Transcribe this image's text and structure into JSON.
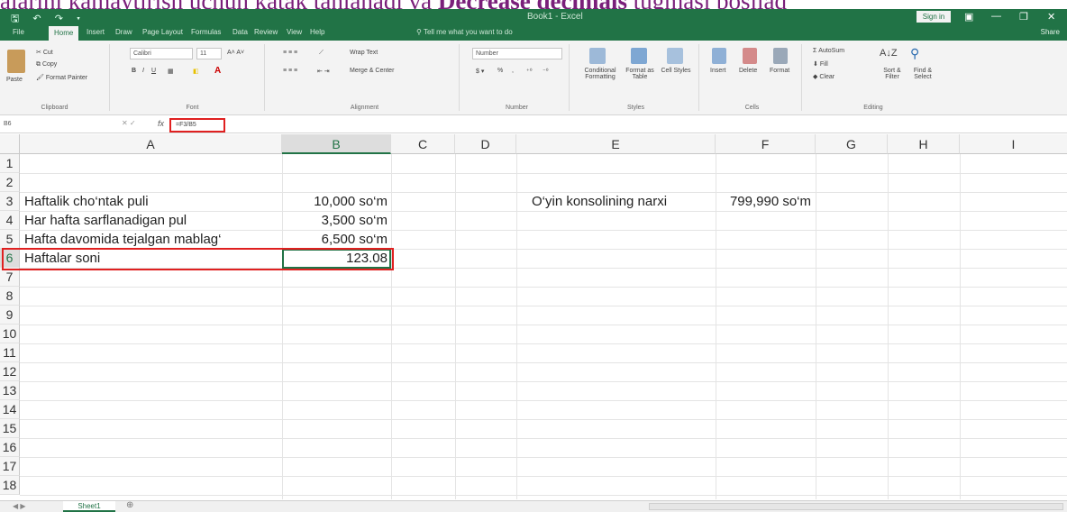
{
  "caption": {
    "prefix": "alarini kamaytirish uchun katak tanlanadi va ",
    "bold": "Decrease decimals",
    "suffix": " tugmasi bosilad"
  },
  "titlebar": {
    "quick_access": "🖫 ↶ ↷ ▾",
    "window_title": "Book1 - Excel",
    "signin": "Sign in",
    "minimize": "—",
    "restore": "❐",
    "close": "✕"
  },
  "tabs": [
    "File",
    "Home",
    "Insert",
    "Draw",
    "Page Layout",
    "Formulas",
    "Data",
    "Review",
    "View",
    "Help"
  ],
  "tell_me": "Tell me what you want to do",
  "share": "Share",
  "ribbon": {
    "clipboard": {
      "paste": "Paste",
      "cut": "Cut",
      "copy": "Copy",
      "format_painter": "Format Painter",
      "label": "Clipboard"
    },
    "font": {
      "name": "Calibri",
      "size": "11",
      "label": "Font"
    },
    "alignment": {
      "wrap_text": "Wrap Text",
      "merge_center": "Merge & Center",
      "label": "Alignment"
    },
    "number": {
      "format": "Number",
      "label": "Number"
    },
    "styles": {
      "conditional": "Conditional Formatting",
      "format_table": "Format as Table",
      "cell_styles": "Cell Styles",
      "label": "Styles"
    },
    "cells": {
      "insert": "Insert",
      "delete": "Delete",
      "format": "Format",
      "label": "Cells"
    },
    "editing": {
      "autosum": "AutoSum",
      "fill": "Fill",
      "clear": "Clear",
      "sort_filter": "Sort & Filter",
      "find_select": "Find & Select",
      "label": "Editing"
    }
  },
  "formula_bar": {
    "name_box": "B6",
    "fx": "fx",
    "formula": "=F3/B5"
  },
  "columns": [
    "A",
    "B",
    "C",
    "D",
    "E",
    "F",
    "G",
    "H",
    "I"
  ],
  "rows": [
    "1",
    "2",
    "3",
    "4",
    "5",
    "6",
    "7",
    "8",
    "9",
    "10",
    "11",
    "12",
    "13",
    "14",
    "15",
    "16",
    "17",
    "18"
  ],
  "cells": {
    "a3": "Haftalik cho‘ntak puli",
    "b3": "10,000 so‘m",
    "a4": "Har hafta sarflanadigan pul",
    "b4": "3,500 so‘m",
    "a5": "Hafta davomida tejalgan mablag‘",
    "b5": "6,500 so‘m",
    "a6": "Haftalar soni",
    "b6": "123.08",
    "e3": "O‘yin konsolining narxi",
    "f3": "799,990 so‘m"
  },
  "sheet_tab": "Sheet1",
  "add_sheet": "⊕",
  "colors": {
    "excel_green": "#217346",
    "highlight_red": "#e02020"
  }
}
